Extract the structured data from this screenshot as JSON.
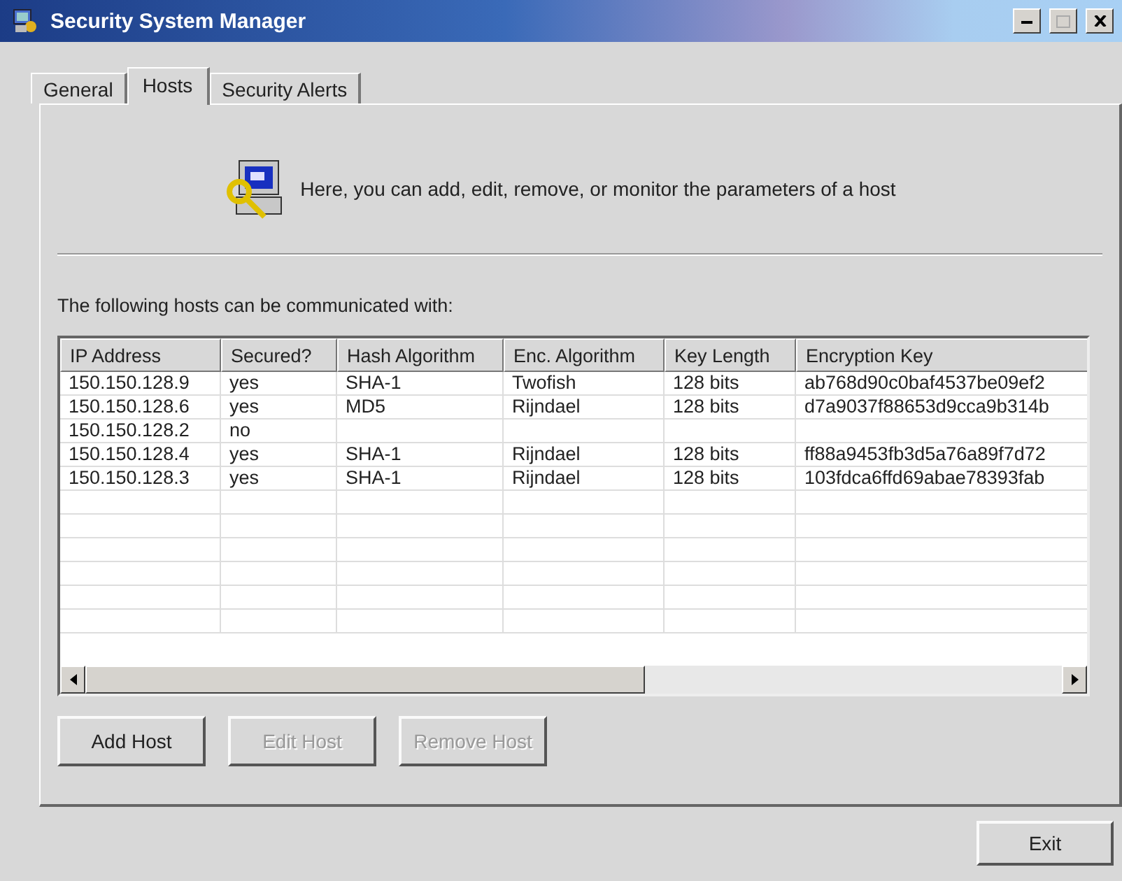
{
  "window": {
    "title": "Security System Manager"
  },
  "tabs": [
    {
      "label": "General",
      "selected": false
    },
    {
      "label": "Hosts",
      "selected": true
    },
    {
      "label": "Security Alerts",
      "selected": false
    }
  ],
  "intro": "Here, you can add, edit, remove, or monitor the parameters of a host",
  "table_label": "The following hosts can be communicated with:",
  "table": {
    "columns": [
      "IP Address",
      "Secured?",
      "Hash Algorithm",
      "Enc. Algorithm",
      "Key Length",
      "Encryption Key"
    ],
    "rows": [
      [
        "150.150.128.9",
        "yes",
        "SHA-1",
        "Twofish",
        "128 bits",
        "ab768d90c0baf4537be09ef2"
      ],
      [
        "150.150.128.6",
        "yes",
        "MD5",
        "Rijndael",
        "128 bits",
        "d7a9037f88653d9cca9b314b"
      ],
      [
        "150.150.128.2",
        "no",
        "",
        "",
        "",
        ""
      ],
      [
        "150.150.128.4",
        "yes",
        "SHA-1",
        "Rijndael",
        "128 bits",
        "ff88a9453fb3d5a76a89f7d72"
      ],
      [
        "150.150.128.3",
        "yes",
        "SHA-1",
        "Rijndael",
        "128 bits",
        "103fdca6ffd69abae78393fab"
      ]
    ]
  },
  "buttons": [
    {
      "label": "Add Host",
      "disabled": false
    },
    {
      "label": "Edit Host",
      "disabled": true
    },
    {
      "label": "Remove Host",
      "disabled": true
    }
  ],
  "exit_button": "Exit"
}
